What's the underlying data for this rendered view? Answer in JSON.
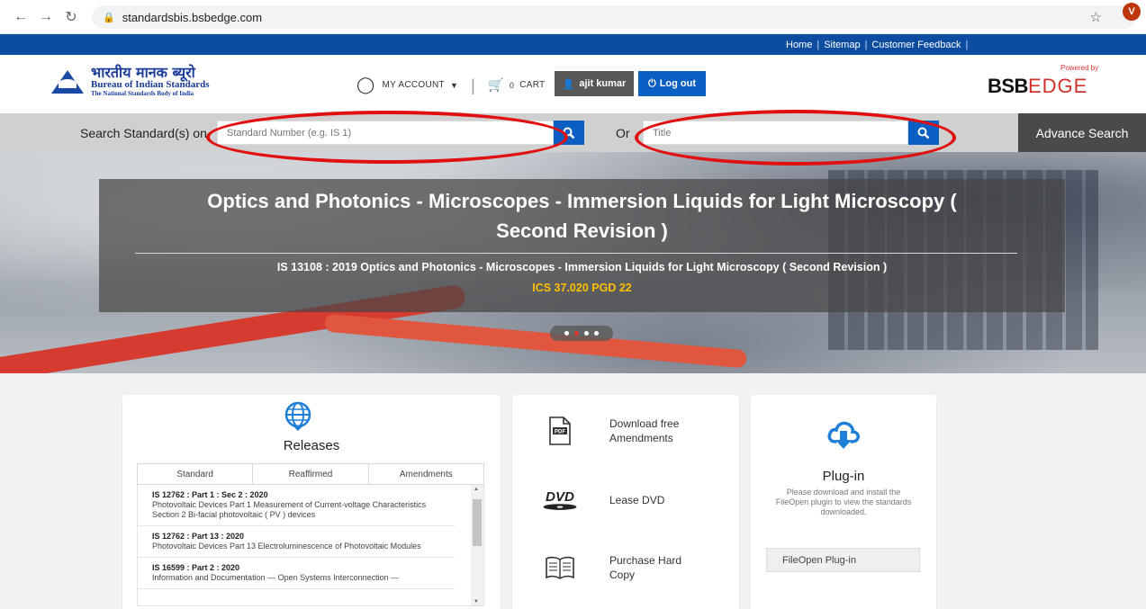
{
  "browser": {
    "url": "standardsbis.bsbedge.com",
    "avatar_letter": "V"
  },
  "toplinks": [
    "Home",
    "Sitemap",
    "Customer Feedback"
  ],
  "logo": {
    "hindi": "भारतीय मानक ब्यूरो",
    "english": "Bureau of Indian Standards",
    "tagline": "The National Standards Body of India"
  },
  "header": {
    "my_account": "MY ACCOUNT",
    "cart_count": "0",
    "cart": "CART",
    "user": "ajit kumar",
    "logout": "Log out",
    "powered_by": "Powered by",
    "brand_bsb": "BSB",
    "brand_edge": "EDGE"
  },
  "search": {
    "label": "Search Standard(s) on",
    "number_placeholder": "Standard Number (e.g. IS 1)",
    "or": "Or",
    "title_placeholder": "Title",
    "advance": "Advance Search"
  },
  "hero": {
    "title": "Optics and Photonics - Microscopes - Immersion Liquids for Light Microscopy ( Second Revision )",
    "subtitle": "IS 13108 : 2019 Optics and Photonics - Microscopes - Immersion Liquids for Light Microscopy ( Second Revision )",
    "ics": "ICS 37.020 PGD 22"
  },
  "releases": {
    "heading": "Releases",
    "tabs": [
      "Standard",
      "Reaffirmed",
      "Amendments"
    ],
    "items": [
      {
        "title": "IS 12762 : Part 1 : Sec 2 : 2020",
        "desc": "Photovoltaic Devices Part 1 Measurement of Current-voltage Characteristics Section 2 Bi-facial photovoltaic ( PV ) devices"
      },
      {
        "title": "IS 12762 : Part 13 : 2020",
        "desc": "Photovoltaic Devices Part 13 Electroluminescence of Photovoltaic Modules"
      },
      {
        "title": "IS 16599 : Part 2 : 2020",
        "desc": "Information and Documentation — Open Systems Interconnection —"
      }
    ]
  },
  "services": {
    "download": "Download free Amendments",
    "lease": "Lease DVD",
    "purchase": "Purchase Hard Copy",
    "pdf_icon_text": "PDF",
    "dvd_icon_text": "DVD"
  },
  "plugin": {
    "heading": "Plug-in",
    "desc": "Please download and install the FileOpen plugin to view the standards downloaded.",
    "button": "FileOpen Plug-in"
  },
  "colors": {
    "brand_blue": "#0c4da2",
    "button_blue": "#0c5fc2",
    "highlight_red": "#e01010",
    "ics_yellow": "#ffc000"
  }
}
